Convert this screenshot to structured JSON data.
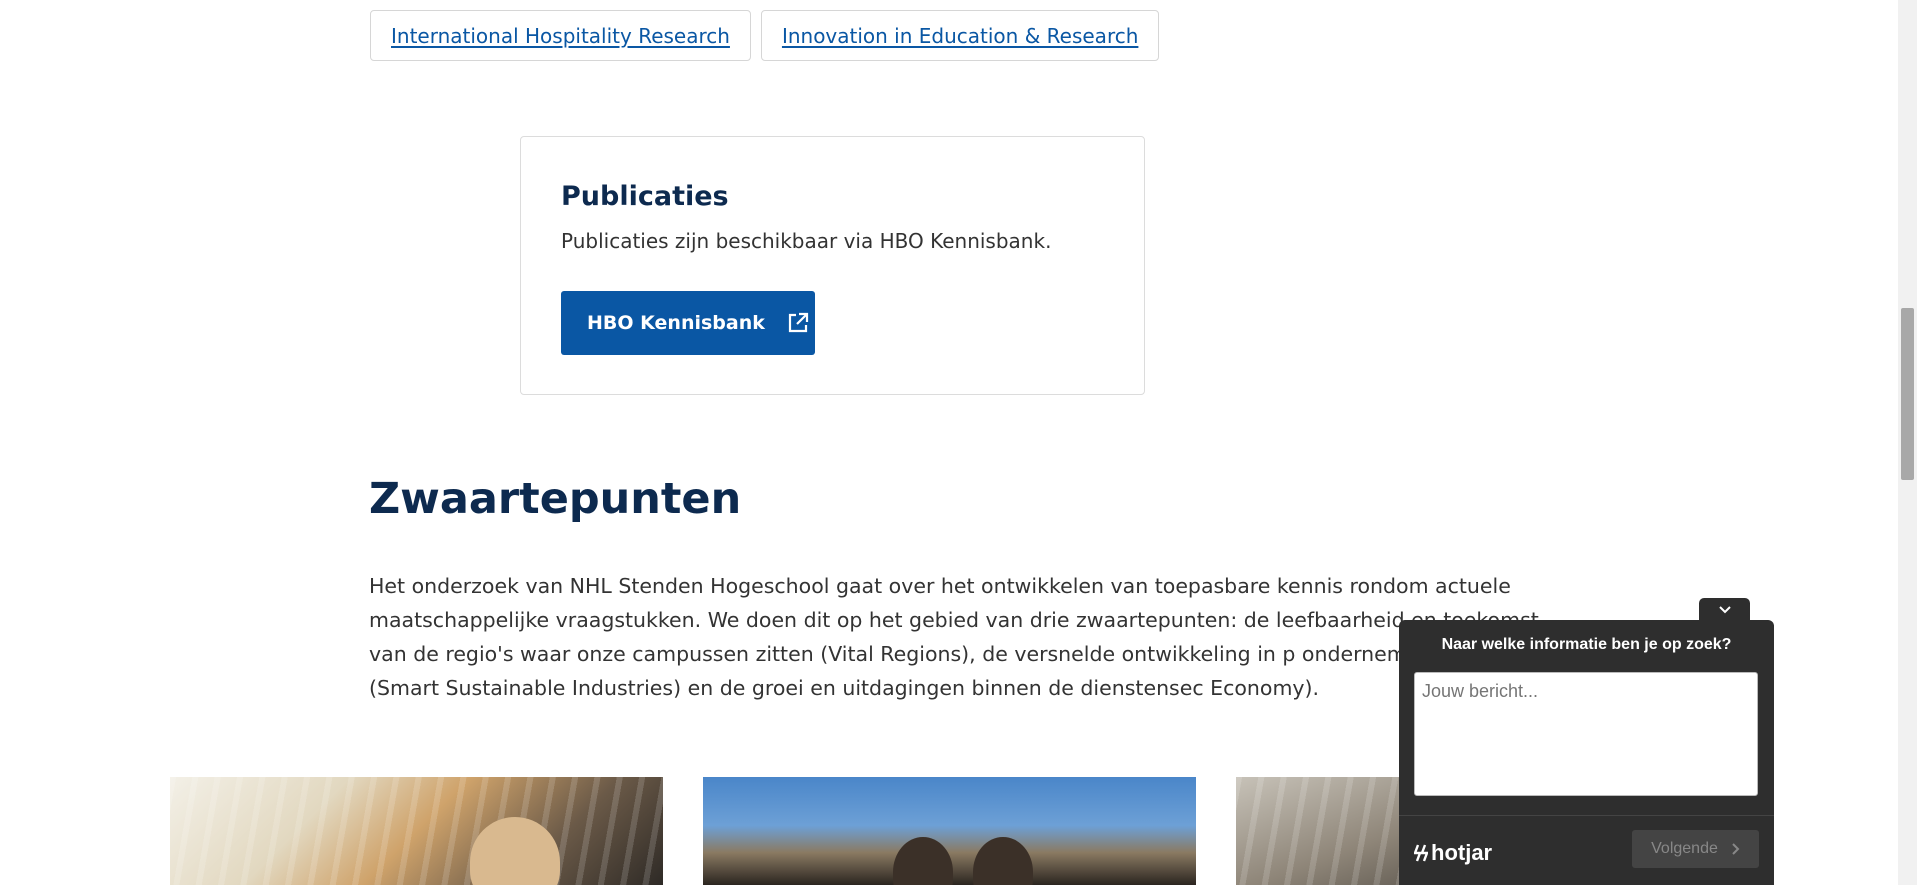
{
  "tags": [
    {
      "label": "International Hospitality Research"
    },
    {
      "label": "Innovation in Education & Research"
    }
  ],
  "publicaties": {
    "title": "Publicaties",
    "text": "Publicaties zijn beschikbaar via HBO Kennisbank.",
    "button_label": "HBO Kennisbank",
    "button_icon": "external-link-icon"
  },
  "zwaartepunten": {
    "title": "Zwaartepunten",
    "body": "Het onderzoek van NHL Stenden Hogeschool gaat over het ontwikkelen van toepasbare kennis rondom actuele maatschappelijke vraagstukken. We doen dit op het gebied van drie zwaartepunten: de leefbaarheid en toekomst van de regio's waar onze campussen zitten (Vital Regions), de versnelde ontwikkeling in p ondernemerschap (Smart Sustainable Industries) en de groei en uitdagingen binnen de dienstensec Economy)."
  },
  "hotjar": {
    "question": "Naar welke informatie ben je op zoek?",
    "placeholder": "Jouw bericht...",
    "logo_text": "hotjar",
    "next_label": "Volgende",
    "toggle_icon": "chevron-down-icon"
  },
  "colors": {
    "link": "#0a57a4",
    "heading": "#0d2a4f",
    "button": "#0a57a4",
    "widget_bg": "#2e2e2e"
  }
}
